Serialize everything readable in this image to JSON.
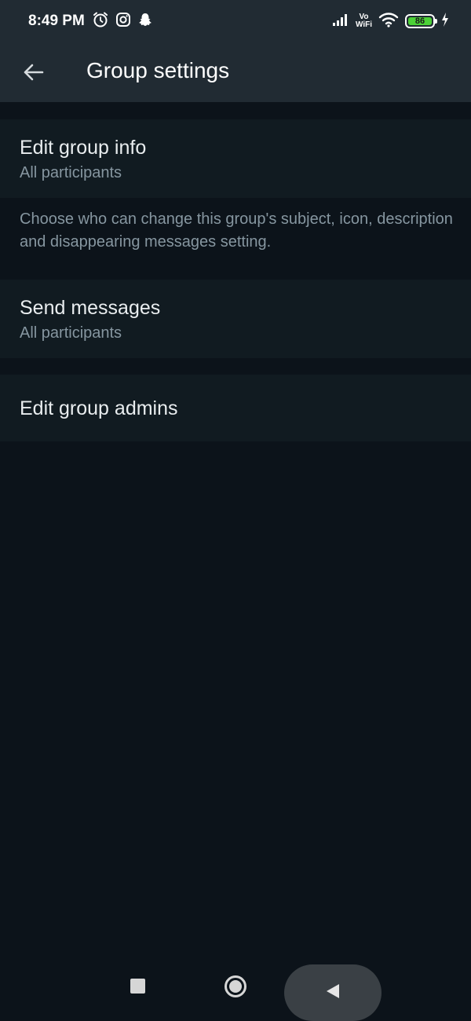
{
  "status_bar": {
    "time": "8:49 PM",
    "left_icons": [
      "alarm-icon",
      "instagram-icon",
      "snapchat-icon"
    ],
    "vowifi_line1": "Vo",
    "vowifi_line2": "WiFi",
    "battery_level": "86",
    "right_icons": [
      "signal-icon",
      "vowifi-icon",
      "wifi-icon",
      "battery-icon",
      "charging-icon"
    ]
  },
  "app_bar": {
    "title": "Group settings",
    "back_icon": "arrow-back-icon"
  },
  "settings": {
    "edit_group_info": {
      "title": "Edit group info",
      "value": "All participants",
      "description": "Choose who can change this group's subject, icon, description and disappearing messages setting."
    },
    "send_messages": {
      "title": "Send messages",
      "value": "All participants"
    },
    "edit_group_admins": {
      "title": "Edit group admins"
    }
  },
  "nav_bar": {
    "icons": [
      "recents-icon",
      "home-icon",
      "back-icon"
    ]
  },
  "colors": {
    "background": "#0c131a",
    "bar": "#212b33",
    "row": "#111b21",
    "primary_text": "#e9edef",
    "secondary_text": "#8696a0",
    "battery": "#4cd137"
  }
}
